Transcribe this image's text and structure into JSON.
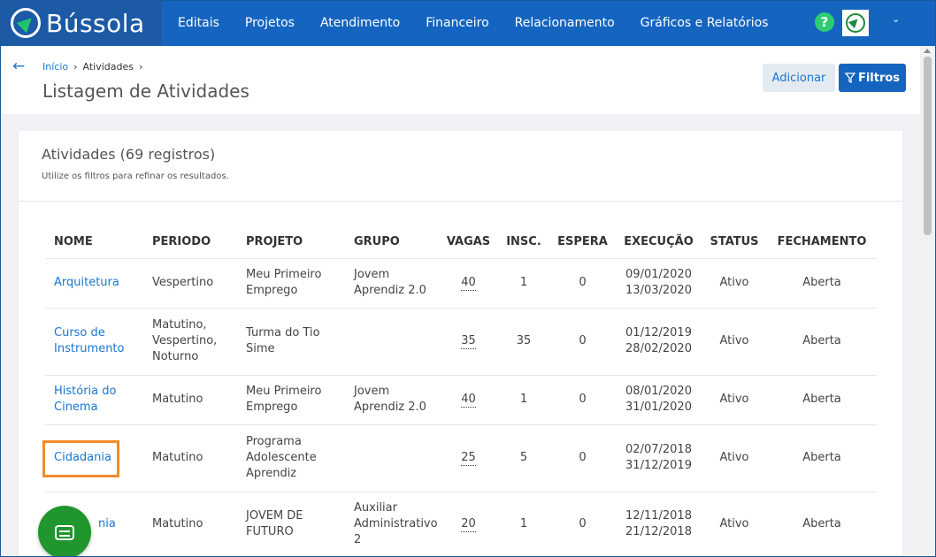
{
  "app": {
    "logo_text": "Bússola",
    "brand_color": "#1565c0",
    "accent_color": "#21962e"
  },
  "nav": {
    "items": [
      {
        "label": "Editais"
      },
      {
        "label": "Projetos"
      },
      {
        "label": "Atendimento"
      },
      {
        "label": "Financeiro"
      },
      {
        "label": "Relacionamento"
      },
      {
        "label": "Gráficos e Relatórios"
      }
    ],
    "help_label": "?"
  },
  "breadcrumb": {
    "home": "Início",
    "current": "Atividades",
    "sep": "›"
  },
  "page": {
    "title": "Listagem de Atividades",
    "add_label": "Adicionar",
    "filter_label": "Filtros"
  },
  "card": {
    "title": "Atividades (69 registros)",
    "subtitle": "Utilize os filtros para refinar os resultados."
  },
  "table": {
    "headers": [
      "NOME",
      "PERIODO",
      "PROJETO",
      "GRUPO",
      "VAGAS",
      "INSC.",
      "ESPERA",
      "EXECUÇÃO",
      "STATUS",
      "FECHAMENTO"
    ],
    "rows": [
      {
        "nome": "Arquitetura",
        "periodo": "Vespertino",
        "projeto": "Meu Primeiro Emprego",
        "grupo": "Jovem Aprendiz 2.0",
        "vagas": "40",
        "insc": "1",
        "espera": "0",
        "exec_start": "09/01/2020",
        "exec_end": "13/03/2020",
        "status": "Ativo",
        "fechamento": "Aberta"
      },
      {
        "nome": "Curso de Instrumento",
        "periodo": "Matutino, Vespertino, Noturno",
        "projeto": "Turma do Tio Sime",
        "grupo": "",
        "vagas": "35",
        "insc": "35",
        "espera": "0",
        "exec_start": "01/12/2019",
        "exec_end": "28/02/2020",
        "status": "Ativo",
        "fechamento": "Aberta"
      },
      {
        "nome": "História do Cinema",
        "periodo": "Matutino",
        "projeto": "Meu Primeiro Emprego",
        "grupo": "Jovem Aprendiz 2.0",
        "vagas": "40",
        "insc": "1",
        "espera": "0",
        "exec_start": "08/01/2020",
        "exec_end": "31/01/2020",
        "status": "Ativo",
        "fechamento": "Aberta"
      },
      {
        "nome": "Cidadania",
        "periodo": "Matutino",
        "projeto": "Programa Adolescente Aprendiz",
        "grupo": "",
        "vagas": "25",
        "insc": "5",
        "espera": "0",
        "exec_start": "02/07/2018",
        "exec_end": "31/12/2019",
        "status": "Ativo",
        "fechamento": "Aberta"
      },
      {
        "nome": "nia",
        "periodo": "Matutino",
        "projeto": "JOVEM DE FUTURO",
        "grupo": "Auxiliar Administrativo 2",
        "vagas": "20",
        "insc": "1",
        "espera": "0",
        "exec_start": "12/11/2018",
        "exec_end": "21/12/2018",
        "status": "Ativo",
        "fechamento": "Aberta"
      }
    ]
  },
  "icons": {
    "back": "arrow-left-icon",
    "help": "question-circle-icon",
    "filter": "funnel-icon",
    "chat": "chat-icon",
    "dropdown": "chevron-down-icon"
  }
}
